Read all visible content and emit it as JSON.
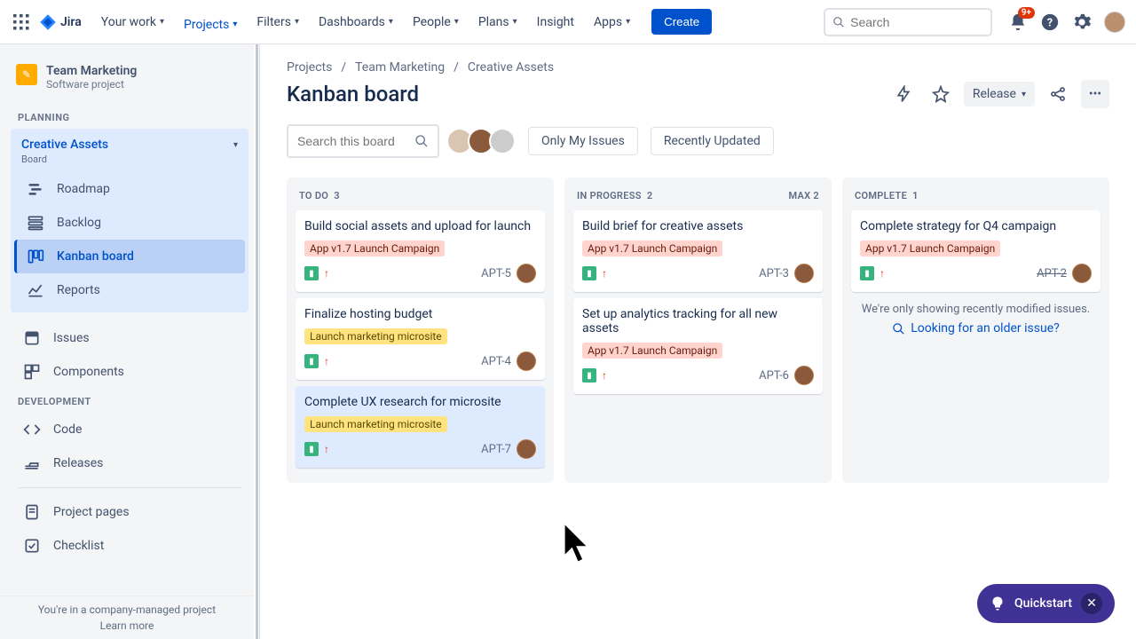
{
  "brand": "Jira",
  "nav": {
    "your_work": "Your work",
    "projects": "Projects",
    "filters": "Filters",
    "dashboards": "Dashboards",
    "people": "People",
    "plans": "Plans",
    "insight": "Insight",
    "apps": "Apps",
    "create": "Create",
    "search_placeholder": "Search",
    "notif_badge": "9+"
  },
  "sidebar": {
    "project_name": "Team Marketing",
    "project_type": "Software project",
    "section_planning": "Planning",
    "section_development": "Development",
    "group_title": "Creative Assets",
    "group_sub": "Board",
    "items": {
      "roadmap": "Roadmap",
      "backlog": "Backlog",
      "kanban": "Kanban board",
      "reports": "Reports",
      "issues": "Issues",
      "components": "Components",
      "code": "Code",
      "releases": "Releases",
      "project_pages": "Project pages",
      "checklist": "Checklist"
    },
    "footer_text": "You're in a company-managed project",
    "footer_link": "Learn more"
  },
  "breadcrumb": {
    "c1": "Projects",
    "c2": "Team Marketing",
    "c3": "Creative Assets"
  },
  "page_title": "Kanban board",
  "header_actions": {
    "release": "Release"
  },
  "controls": {
    "search_placeholder": "Search this board",
    "only_my": "Only My Issues",
    "recent": "Recently Updated"
  },
  "columns": {
    "todo": {
      "title": "To Do",
      "count": "3"
    },
    "inprogress": {
      "title": "In Progress",
      "count": "2",
      "limit": "Max 2"
    },
    "complete": {
      "title": "Complete",
      "count": "1"
    }
  },
  "epics": {
    "pink": "App v1.7 Launch Campaign",
    "yellow": "Launch marketing microsite"
  },
  "cards": {
    "apt5": {
      "title": "Build social assets and upload for launch",
      "key": "APT-5"
    },
    "apt4": {
      "title": "Finalize hosting budget",
      "key": "APT-4"
    },
    "apt7": {
      "title": "Complete UX research for microsite",
      "key": "APT-7"
    },
    "apt3": {
      "title": "Build brief for creative assets",
      "key": "APT-3"
    },
    "apt6": {
      "title": "Set up analytics tracking for all new assets",
      "key": "APT-6"
    },
    "apt2": {
      "title": "Complete strategy for Q4 campaign",
      "key": "APT-2"
    }
  },
  "done_note": "We're only showing recently modified issues.",
  "older_link": "Looking for an older issue?",
  "quickstart": "Quickstart"
}
